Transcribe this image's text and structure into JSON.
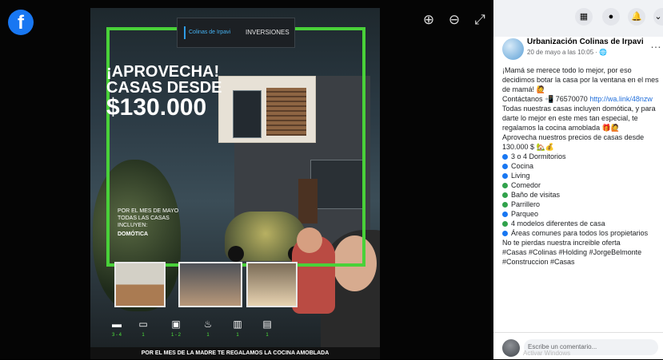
{
  "viewer": {
    "brand_icon": "f",
    "tools": {
      "zoom_in": "⊕",
      "zoom_out": "⊖",
      "fullscreen": "⤢"
    }
  },
  "advert": {
    "logo_left": "Colinas de Irpavi",
    "logo_right": "INVERSIONES",
    "headline": [
      "¡APROVECHA!",
      "CASAS DESDE",
      "$130.000"
    ],
    "promo_lines": [
      "POR EL MES DE MAYO",
      "TODAS LAS CASAS",
      "INCLUYEN:",
      "DOMÓTICA"
    ],
    "feature_counts": [
      "3 - 4",
      "1",
      "1 - 2",
      "1",
      "1",
      "1"
    ],
    "footer": "POR EL MES DE LA MADRE TE REGALAMOS LA COCINA AMOBLADA"
  },
  "post": {
    "author": "Urbanización Colinas de Irpavi",
    "date": "20 de mayo a las 10:05 · 🌐",
    "lines": [
      "¡Mamá se merece todo lo mejor, por eso",
      "decidimos botar la casa por la ventana en el mes",
      "de mamá! 🙋",
      "Contáctanos 📲 76570070",
      "Todas nuestras casas incluyen domótica, y para",
      "darte lo mejor en este mes tan especial, te",
      "regalamos la cocina amoblada 🎁🙋",
      "Aprovecha nuestros precios de casas desde",
      "130.000 $ 🏡💰"
    ],
    "link": "http://wa.link/48nzw",
    "list_items": [
      "3 o 4 Dormitorios",
      "Cocina",
      "Living",
      "Comedor",
      "Baño de visitas",
      "Parrillero",
      "Parqueo",
      "4 modelos diferentes de casa",
      "Áreas comunes para todos los propietarios"
    ],
    "closing": [
      "No te pierdas nuestra increible oferta",
      "#Casas #Colinas #Holding #JorgeBelmonte",
      "#Construccion #Casas"
    ]
  },
  "comment": {
    "placeholder": "Escribe un comentario...",
    "watermark": "Activar Windows"
  }
}
